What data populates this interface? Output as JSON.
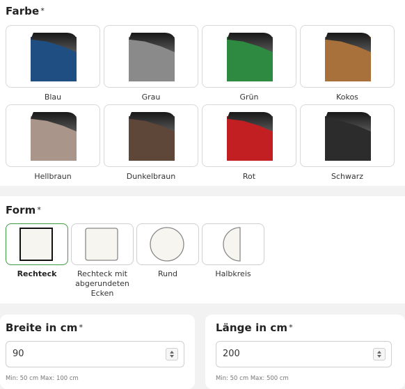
{
  "farbe": {
    "title": "Farbe",
    "required_mark": "*",
    "options": [
      {
        "label": "Blau",
        "color": "#1f4f82"
      },
      {
        "label": "Grau",
        "color": "#8a8a8a"
      },
      {
        "label": "Grün",
        "color": "#2e8a40"
      },
      {
        "label": "Kokos",
        "color": "#a8703a"
      },
      {
        "label": "Hellbraun",
        "color": "#a9958a"
      },
      {
        "label": "Dunkelbraun",
        "color": "#5e4638"
      },
      {
        "label": "Rot",
        "color": "#c21f23"
      },
      {
        "label": "Schwarz",
        "color": "#2c2c2c"
      }
    ]
  },
  "form": {
    "title": "Form",
    "required_mark": "*",
    "options": [
      {
        "label": "Rechteck",
        "selected": true
      },
      {
        "label": "Rechteck mit abgerundeten Ecken",
        "selected": false
      },
      {
        "label": "Rund",
        "selected": false
      },
      {
        "label": "Halbkreis",
        "selected": false
      }
    ]
  },
  "breite": {
    "title": "Breite in cm",
    "required_mark": "*",
    "value": "90",
    "hint": "Min: 50 cm  Max: 100 cm"
  },
  "laenge": {
    "title": "Länge in cm",
    "required_mark": "*",
    "value": "200",
    "hint": "Min: 50 cm  Max: 500 cm"
  },
  "colors": {
    "selected_border": "#3e9a3e",
    "shape_fill": "#f7f5f0"
  }
}
